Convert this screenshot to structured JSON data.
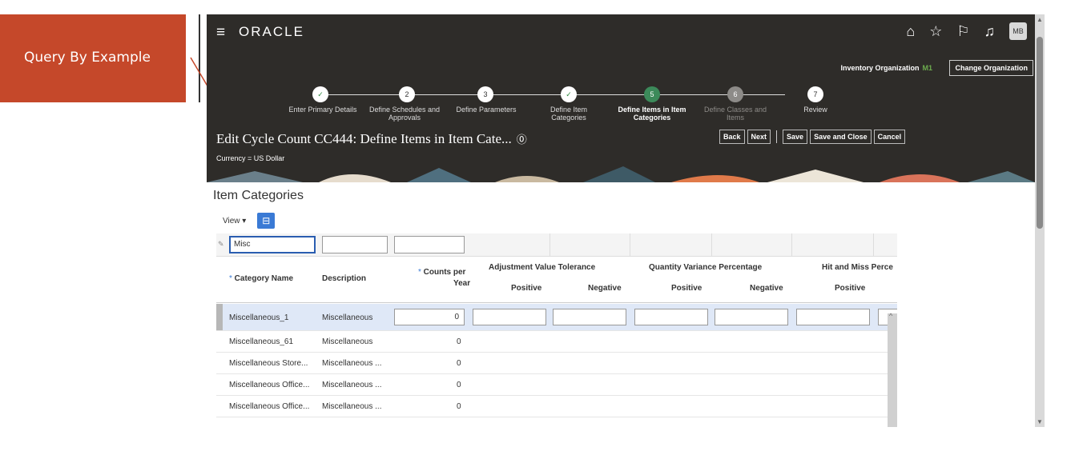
{
  "callout": {
    "label": "Query By Example"
  },
  "header": {
    "logo": "ORACLE",
    "avatar": "MB"
  },
  "org": {
    "label": "Inventory Organization",
    "code": "M1",
    "change_button": "Change Organization"
  },
  "train": [
    {
      "num": "✓",
      "label": "Enter Primary Details",
      "state": "done"
    },
    {
      "num": "2",
      "label": "Define Schedules and Approvals",
      "state": "normal"
    },
    {
      "num": "3",
      "label": "Define Parameters",
      "state": "normal"
    },
    {
      "num": "✓",
      "label": "Define Item Categories",
      "state": "done"
    },
    {
      "num": "5",
      "label": "Define Items in Item Categories",
      "state": "current"
    },
    {
      "num": "6",
      "label": "Define Classes and Items",
      "state": "disabled"
    },
    {
      "num": "7",
      "label": "Review",
      "state": "normal"
    }
  ],
  "page": {
    "title": "Edit Cycle Count CC444: Define Items in Item Cate...",
    "currency": "Currency = US Dollar"
  },
  "buttons": {
    "back": "Back",
    "next": "Next",
    "save": "Save",
    "save_close": "Save and Close",
    "cancel": "Cancel"
  },
  "section": {
    "title": "Item Categories",
    "view": "View ▾"
  },
  "query": {
    "category": "Misc"
  },
  "columns": {
    "category": "Category Name",
    "description": "Description",
    "counts": "Counts per",
    "counts2": "Year",
    "adj": "Adjustment Value Tolerance",
    "qty": "Quantity Variance Percentage",
    "hit": "Hit and Miss Perce",
    "positive": "Positive",
    "negative": "Negative"
  },
  "rows": [
    {
      "name": "Miscellaneous_1",
      "desc": "Miscellaneous",
      "counts": "0"
    },
    {
      "name": "Miscellaneous_61",
      "desc": "Miscellaneous",
      "counts": "0"
    },
    {
      "name": "Miscellaneous Store...",
      "desc": "Miscellaneous ...",
      "counts": "0"
    },
    {
      "name": "Miscellaneous Office...",
      "desc": "Miscellaneous ...",
      "counts": "0"
    },
    {
      "name": "Miscellaneous Office...",
      "desc": "Miscellaneous ...",
      "counts": "0"
    }
  ]
}
